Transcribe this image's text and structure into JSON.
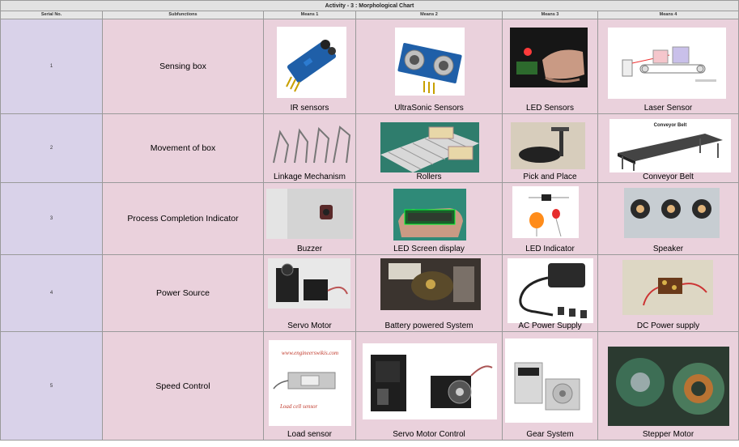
{
  "title": "Activity - 3 : Morphological Chart",
  "headers": {
    "serial": "Serial No.",
    "subfunctions": "Subfunctions",
    "means1": "Means 1",
    "means2": "Means 2",
    "means3": "Means 3",
    "means4": "Means 4"
  },
  "rows": [
    {
      "serial": "1",
      "subfunction": "Sensing box",
      "means": [
        "IR sensors",
        "UltraSonic Sensors",
        "LED Sensors",
        "Laser Sensor"
      ]
    },
    {
      "serial": "2",
      "subfunction": "Movement of box",
      "means": [
        "Linkage Mechanism",
        "Rollers",
        "Pick and Place",
        "Conveyor Belt"
      ]
    },
    {
      "serial": "3",
      "subfunction": "Process Completion Indicator",
      "means": [
        "Buzzer",
        "LED Screen display",
        "LED Indicator",
        "Speaker"
      ]
    },
    {
      "serial": "4",
      "subfunction": "Power Source",
      "means": [
        "Servo Motor",
        "Battery powered System",
        "AC Power Supply",
        "DC Power supply"
      ]
    },
    {
      "serial": "5",
      "subfunction": "Speed Control",
      "means": [
        "Load sensor",
        "Servo Motor Control",
        "Gear System",
        "Stepper Motor"
      ]
    }
  ],
  "image_text": {
    "conveyor_caption": "Conveyor Belt",
    "watermark_site": "www.engineerswikis.com",
    "loadcell_caption": "Load cell sensor"
  },
  "colors": {
    "serial_bg": "#d9d2e9",
    "cell_bg": "#ead1dc",
    "header_bg": "#e6e6e6",
    "grid": "#9a9a9a"
  }
}
